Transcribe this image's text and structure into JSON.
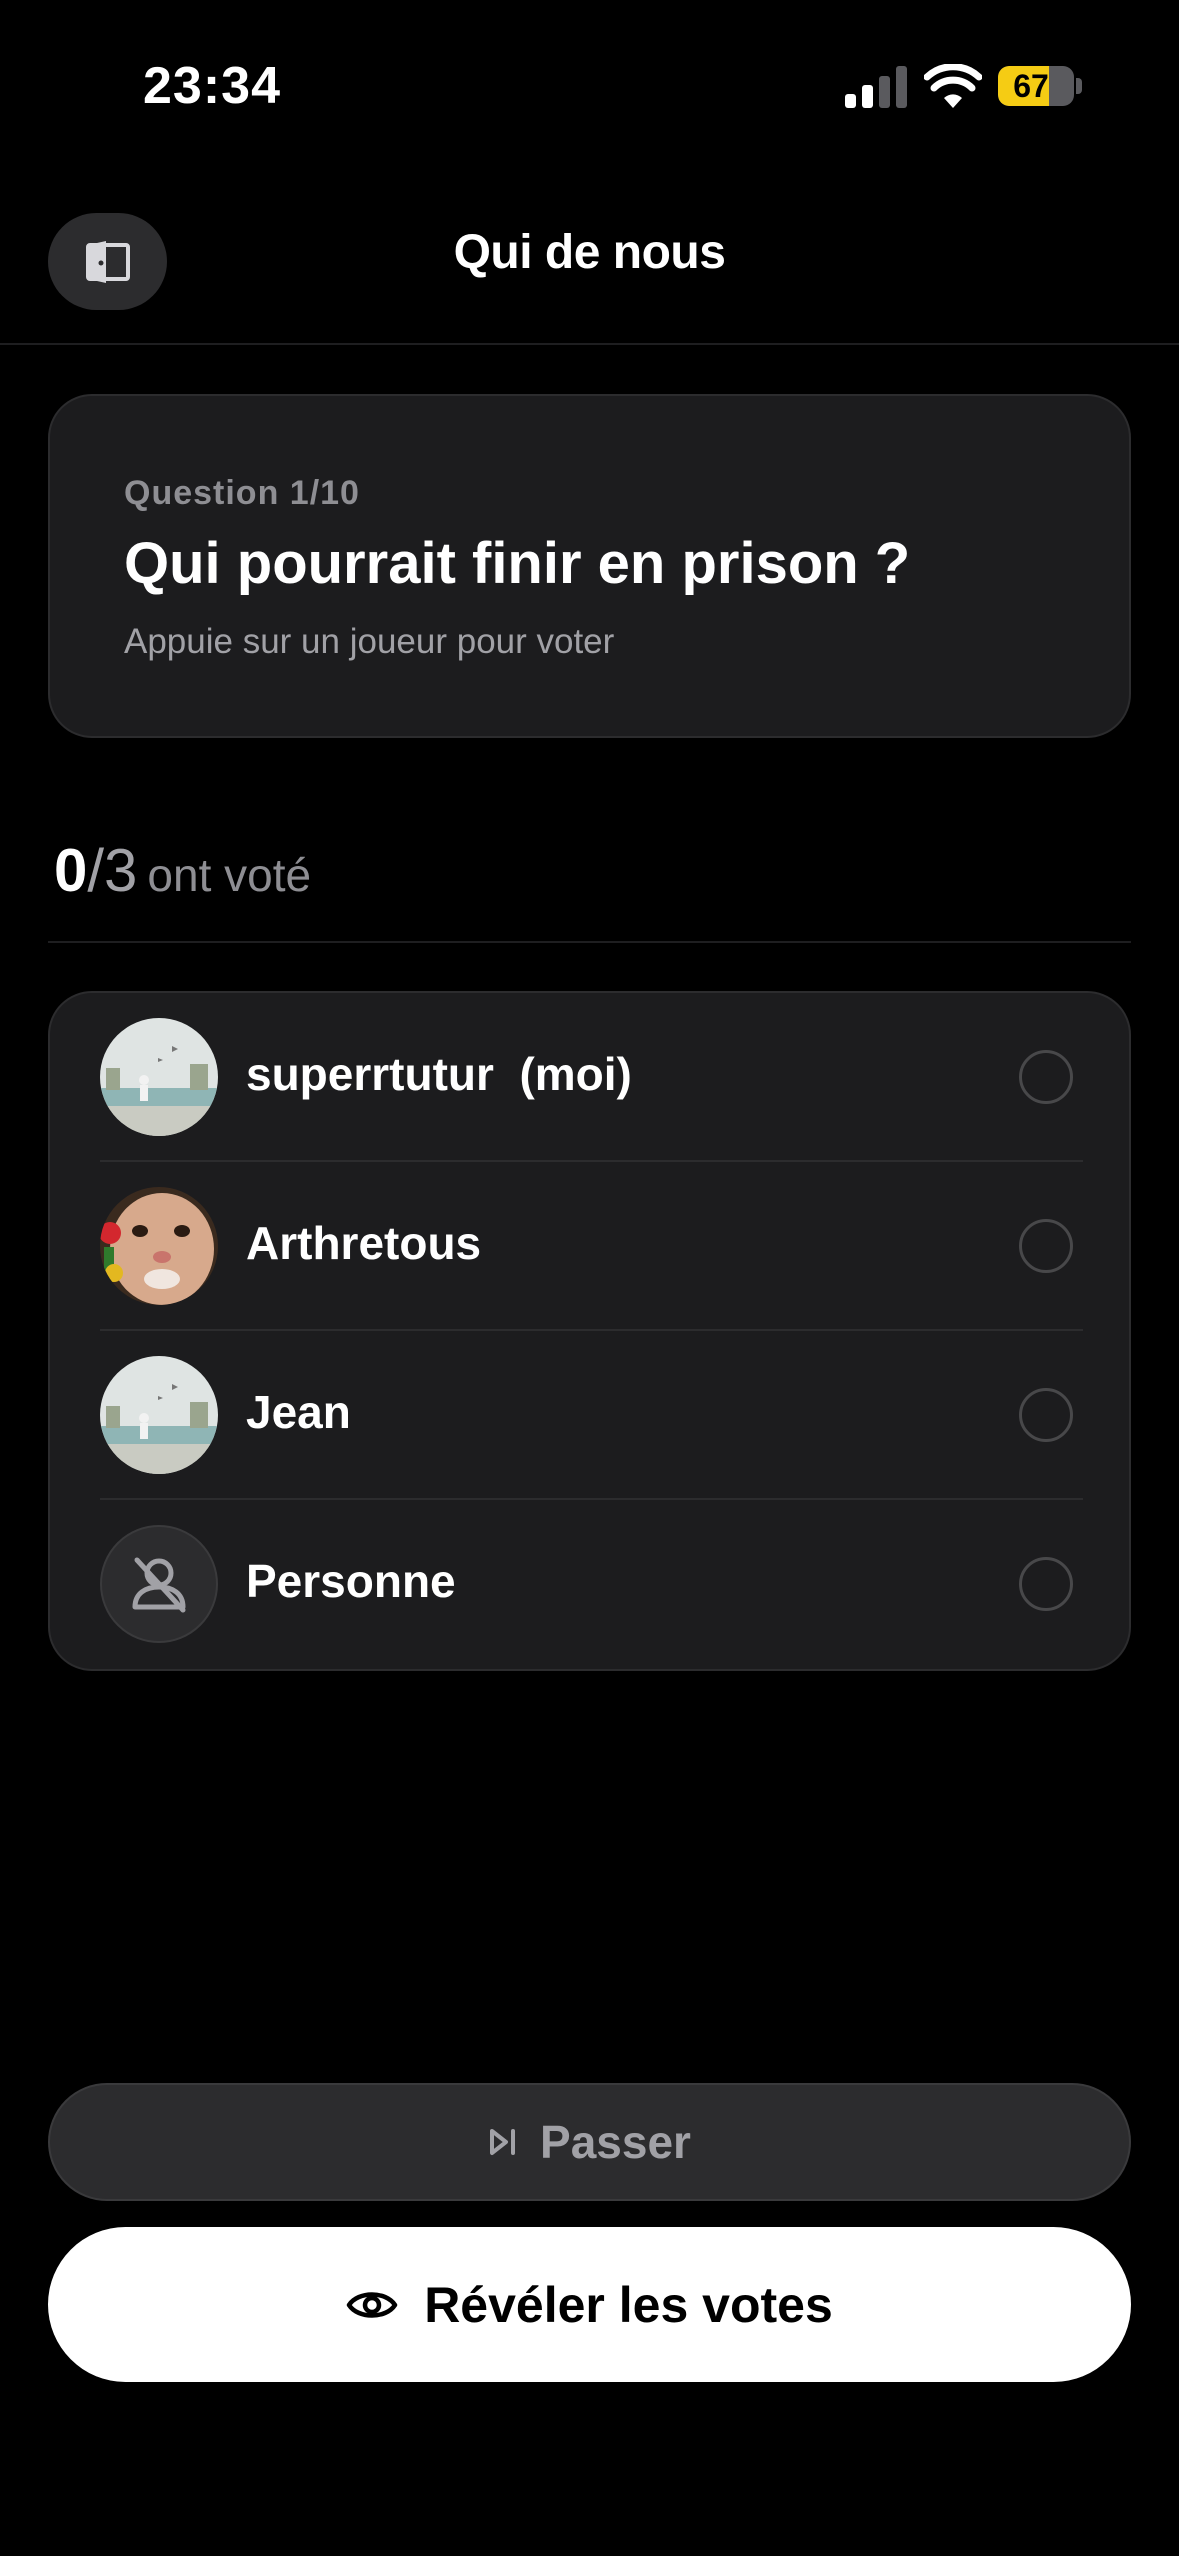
{
  "status_bar": {
    "time": "23:34",
    "battery_level": "67",
    "battery_color": "#f5cc14"
  },
  "header": {
    "title": "Qui de nous",
    "exit_icon": "door-exit-icon"
  },
  "question": {
    "counter": "Question 1/10",
    "text": "Qui pourrait finir en prison ?",
    "hint": "Appuie sur un joueur pour voter"
  },
  "votes": {
    "count": "0",
    "separator": "/",
    "total": "3",
    "label": "ont voté"
  },
  "players": [
    {
      "name": "superrtutur  (moi)",
      "avatar": "beach-stormtrooper-avatar",
      "selected": false
    },
    {
      "name": "Arthretous",
      "avatar": "cat-with-rose-avatar",
      "selected": false
    },
    {
      "name": "Jean",
      "avatar": "beach-stormtrooper-avatar",
      "selected": false
    },
    {
      "name": "Personne",
      "avatar": "no-person-icon",
      "selected": false
    }
  ],
  "actions": {
    "skip_label": "Passer",
    "skip_icon": "skip-forward-icon",
    "reveal_label": "Révéler les votes",
    "reveal_icon": "eye-icon"
  }
}
